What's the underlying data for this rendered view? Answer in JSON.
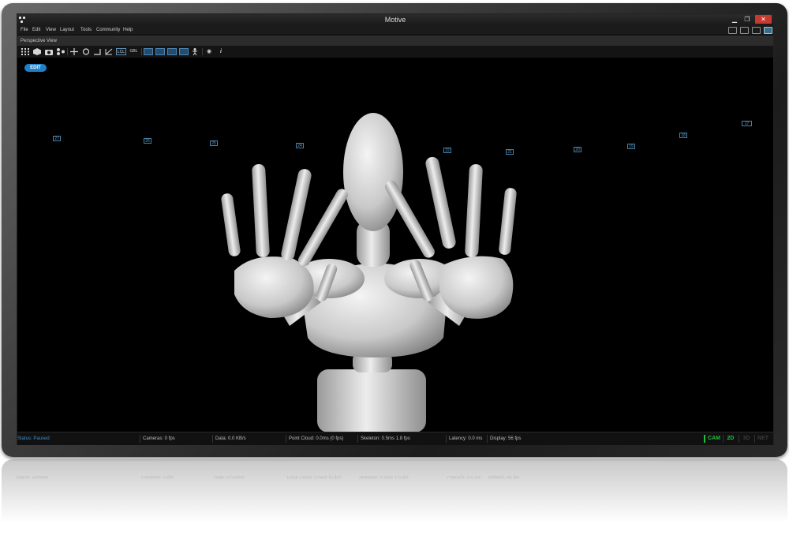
{
  "window": {
    "title": "Motive",
    "min_glyph": "▁",
    "restore_glyph": "❐",
    "close_glyph": "✕"
  },
  "menu": [
    "File",
    "Edit",
    "View",
    "Layout",
    "Tools",
    "Community",
    "Help"
  ],
  "tab": {
    "label": "Perspective View"
  },
  "toolbar": {
    "local_label": "LCL",
    "global_label": "GBL",
    "info_glyph": "i",
    "eye_glyph": "◉"
  },
  "viewport": {
    "edit_label": "EDIT"
  },
  "cameras": [
    "27",
    "26",
    "25",
    "24",
    "22",
    "21",
    "20",
    "19",
    "18",
    "17"
  ],
  "status": {
    "state": "Status: Paused",
    "cameras": "Cameras: 0 fps",
    "data": "Data: 0.0 KB/s",
    "point_cloud": "Point Cloud: 0.0ms (0 fps)",
    "skeleton": "Skeleton: 0.5ms 1.8 fps",
    "latency": "Latency: 0.0 ms",
    "display": "Display: 56 fps"
  },
  "modes": {
    "cam": "CAM",
    "twod": "2D",
    "threed": "3D",
    "net": "NET"
  },
  "colors": {
    "accent": "#1f7fc7",
    "cam_mode": "#1fbf3a",
    "twod_mode": "#1fbf3a",
    "close": "#c63a2f"
  }
}
